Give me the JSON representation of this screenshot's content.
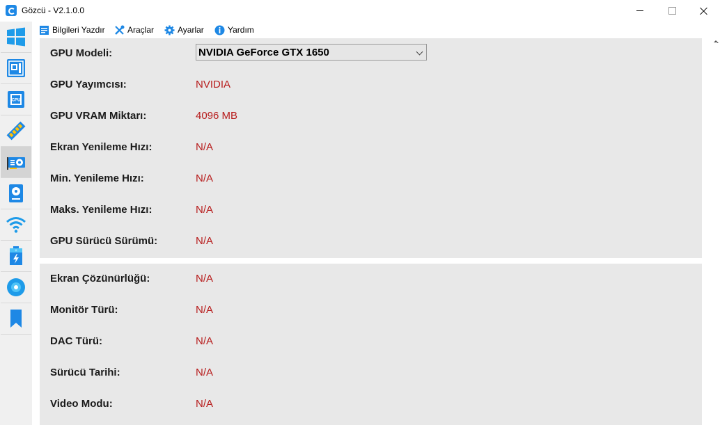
{
  "window": {
    "title": "Gözcü - V2.1.0.0"
  },
  "menu": {
    "items": [
      {
        "label": "Bilgileri Yazdır",
        "icon": "print-info-icon"
      },
      {
        "label": "Araçlar",
        "icon": "tools-icon"
      },
      {
        "label": "Ayarlar",
        "icon": "gear-icon"
      },
      {
        "label": "Yardım",
        "icon": "info-icon"
      }
    ]
  },
  "nav": {
    "items": [
      {
        "icon": "windows-icon",
        "active": false
      },
      {
        "icon": "motherboard-icon",
        "active": false
      },
      {
        "icon": "cpu-icon",
        "active": false
      },
      {
        "icon": "ram-icon",
        "active": false
      },
      {
        "icon": "gpu-icon",
        "active": true
      },
      {
        "icon": "storage-icon",
        "active": false
      },
      {
        "icon": "wifi-icon",
        "active": false
      },
      {
        "icon": "battery-icon",
        "active": false
      },
      {
        "icon": "disc-icon",
        "active": false
      },
      {
        "icon": "bookmark-icon",
        "active": false
      }
    ]
  },
  "gpu": {
    "model_label": "GPU Modeli:",
    "model_value": "NVIDIA GeForce GTX 1650",
    "rows": [
      {
        "label": "GPU Yayımcısı:",
        "value": "NVIDIA"
      },
      {
        "label": "GPU VRAM Miktarı:",
        "value": "4096 MB"
      },
      {
        "label": "Ekran Yenileme Hızı:",
        "value": "N/A"
      },
      {
        "label": "Min. Yenileme Hızı:",
        "value": "N/A"
      },
      {
        "label": "Maks. Yenileme Hızı:",
        "value": "N/A"
      },
      {
        "label": "GPU Sürücü Sürümü:",
        "value": "N/A"
      }
    ]
  },
  "display": {
    "rows": [
      {
        "label": "Ekran Çözünürlüğü:",
        "value": "N/A"
      },
      {
        "label": "Monitör Türü:",
        "value": "N/A"
      },
      {
        "label": "DAC Türü:",
        "value": "N/A"
      },
      {
        "label": "Sürücü Tarihi:",
        "value": "N/A"
      },
      {
        "label": "Video Modu:",
        "value": "N/A"
      }
    ]
  },
  "colors": {
    "value_red": "#b71c1c",
    "accent_blue": "#1e88e5",
    "panel_bg": "#e8e8e8"
  }
}
